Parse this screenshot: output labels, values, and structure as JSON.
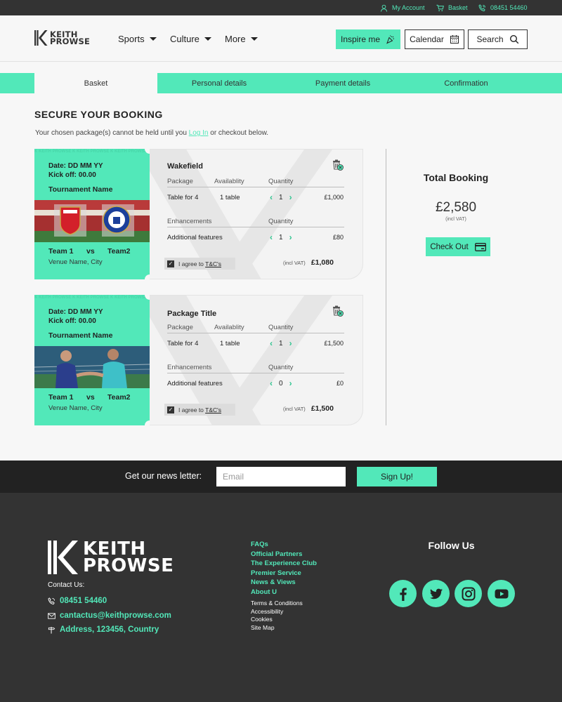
{
  "topbar": {
    "account": "My Account",
    "basket": "Basket",
    "phone": "08451 54460"
  },
  "header": {
    "logo_line1": "KEITH",
    "logo_line2": "PROWSE",
    "nav": [
      "Sports",
      "Culture",
      "More"
    ],
    "inspire": "Inspire me",
    "calendar": "Calendar",
    "search": "Search"
  },
  "steps": [
    "Basket",
    "Personal details",
    "Payment details",
    "Confirmation"
  ],
  "page": {
    "title": "SECURE YOUR BOOKING",
    "intro_before": "Your chosen package(s) cannot be held until you ",
    "intro_link": "Log In",
    "intro_after": " or checkout below."
  },
  "bookings": [
    {
      "date": "Date: DD MM YY",
      "kickoff": "Kick off: 00.00",
      "tournament": "Tournament Name",
      "team1": "Team 1",
      "vs": "vs",
      "team2": "Team2",
      "venue": "Venue Name, City",
      "package_title": "Wakefield",
      "col_package": "Package",
      "col_availability": "Availablity",
      "col_quantity": "Quantity",
      "package_name": "Table for 4",
      "availability": "1 table",
      "package_qty": "1",
      "package_price": "£1,000",
      "enh_label": "Enhancements",
      "enh_quantity": "Quantity",
      "enh_name": "Additional features",
      "enh_qty": "1",
      "enh_price": "£80",
      "agree": "I agree to ",
      "tc": "T&C's",
      "vat": "(incl VAT)",
      "total": "£1,080"
    },
    {
      "date": "Date: DD MM YY",
      "kickoff": "Kick off: 00.00",
      "tournament": "Tournament Name",
      "team1": "Team 1",
      "vs": "vs",
      "team2": "Team2",
      "venue": "Venue Name, City",
      "package_title": "Package Title",
      "col_package": "Package",
      "col_availability": "Availablity",
      "col_quantity": "Quantity",
      "package_name": "Table for 4",
      "availability": "1 table",
      "package_qty": "1",
      "package_price": "£1,500",
      "enh_label": "Enhancements",
      "enh_quantity": "Quantity",
      "enh_name": "Additional features",
      "enh_qty": "0",
      "enh_price": "£0",
      "agree": "I agree to ",
      "tc": "T&C's",
      "vat": "(incl VAT)",
      "total": "£1,500"
    }
  ],
  "summary": {
    "title": "Total Booking",
    "total": "£2,580",
    "vat": "(incl VAT)",
    "checkout": "Check Out"
  },
  "newsletter": {
    "label": "Get our news letter:",
    "placeholder": "Email",
    "button": "Sign Up!"
  },
  "footer": {
    "logo_line1": "KEITH",
    "logo_line2": "PROWSE",
    "contact_label": "Contact Us:",
    "phone": "08451 54460",
    "email": "cantactus@keithprowse.com",
    "address": "Address, 123456, Country",
    "links_primary": [
      "FAQs",
      "Official Partners",
      "The Experience Club",
      "Premier Service",
      "News & Views",
      "About U"
    ],
    "links_secondary": [
      "Terms & Conditions",
      "Accessibility",
      "Cookies",
      "Site Map"
    ],
    "follow": "Follow Us",
    "social": [
      "facebook-icon",
      "twitter-icon",
      "instagram-icon",
      "youtube-icon"
    ]
  },
  "colors": {
    "accent": "#52e8b9",
    "dark": "#333333",
    "newsletter_bg": "#222222",
    "page_bg": "#f7f7f7"
  }
}
